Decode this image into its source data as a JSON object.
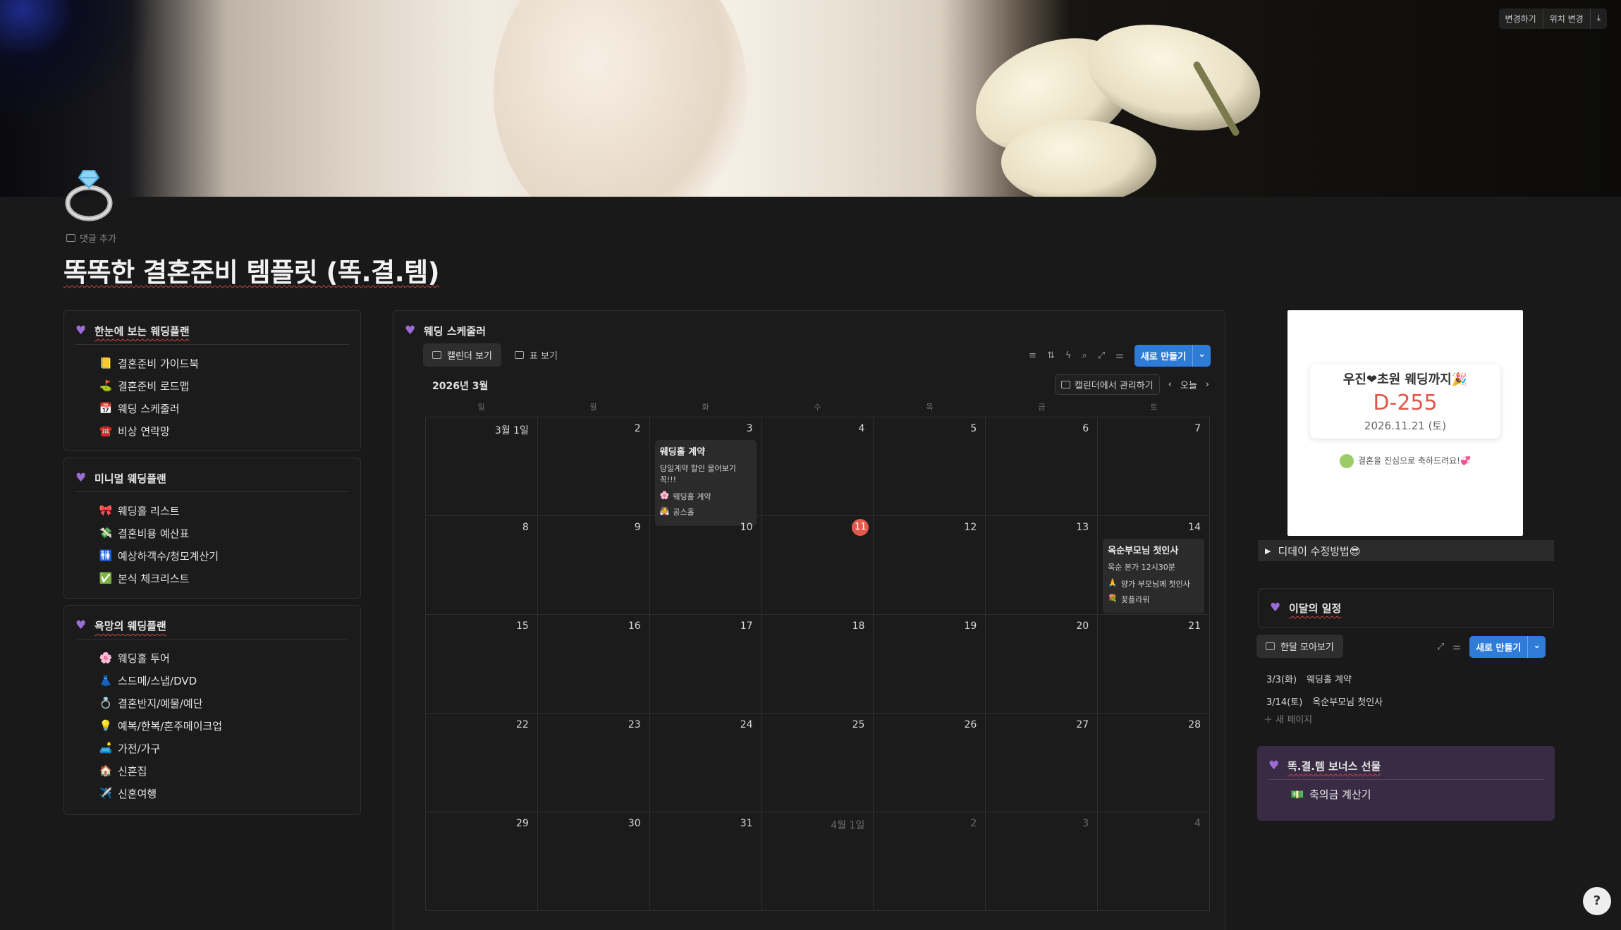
{
  "cover": {
    "change_label": "변경하기",
    "reposition_label": "위치 변경",
    "download_icon": "download-icon"
  },
  "page": {
    "icon": "ring",
    "add_comment": "댓글 추가",
    "title": "똑똑한 결혼준비 템플릿 (똑.결.템)"
  },
  "left_panels": [
    {
      "title": "한눈에 보는 웨딩플랜",
      "items": [
        {
          "emoji": "📒",
          "label": "결혼준비 가이드북"
        },
        {
          "emoji": "⛳",
          "label": "결혼준비 로드맵"
        },
        {
          "emoji": "📅",
          "label": "웨딩 스케줄러"
        },
        {
          "emoji": "☎️",
          "label": "비상 연락망"
        }
      ]
    },
    {
      "title": "미니멀 웨딩플랜",
      "items": [
        {
          "emoji": "🎀",
          "label": "웨딩홀 리스트"
        },
        {
          "emoji": "💸",
          "label": "결혼비용 예산표"
        },
        {
          "emoji": "🚻",
          "label": "예상하객수/청모계산기"
        },
        {
          "emoji": "✅",
          "label": "본식 체크리스트"
        }
      ]
    },
    {
      "title": "욕망의 웨딩플랜",
      "items": [
        {
          "emoji": "🌸",
          "label": "웨딩홀 투어"
        },
        {
          "emoji": "👗",
          "label": "스드메/스냅/DVD"
        },
        {
          "emoji": "💍",
          "label": "결혼반지/예물/예단"
        },
        {
          "emoji": "💡",
          "label": "예복/한복/혼주메이크업"
        },
        {
          "emoji": "🛋️",
          "label": "가전/가구"
        },
        {
          "emoji": "🏠",
          "label": "신혼집"
        },
        {
          "emoji": "✈️",
          "label": "신혼여행"
        }
      ]
    }
  ],
  "scheduler": {
    "title": "웨딩 스케줄러",
    "tabs": [
      "캘린더 보기",
      "표 보기"
    ],
    "new_label": "새로 만들기",
    "month": "2026년 3월",
    "manage_label": "캘린더에서 관리하기",
    "today_label": "오늘",
    "weekdays": [
      "일",
      "월",
      "화",
      "수",
      "목",
      "금",
      "토"
    ],
    "days": [
      "3월 1일",
      "2",
      "3",
      "4",
      "5",
      "6",
      "7",
      "8",
      "9",
      "10",
      "11",
      "12",
      "13",
      "14",
      "15",
      "16",
      "17",
      "18",
      "19",
      "20",
      "21",
      "22",
      "23",
      "24",
      "25",
      "26",
      "27",
      "28",
      "29",
      "30",
      "31",
      "4월 1일",
      "2",
      "3",
      "4"
    ],
    "today_index": 10,
    "events": [
      {
        "day_index": 2,
        "title": "웨딩홀 계약",
        "desc": "당일계약 할인 물어보기 꼭!!!",
        "rows": [
          {
            "emoji": "🌸",
            "text": "웨딩홀 계약"
          },
          {
            "emoji": "👰",
            "text": "공스홀"
          }
        ]
      },
      {
        "day_index": 13,
        "title": "옥순부모님 첫인사",
        "desc": "옥순 본가 12시30분",
        "rows": [
          {
            "emoji": "🙏",
            "text": "양가 부모님께 첫인사"
          },
          {
            "emoji": "💐",
            "text": "꽃플라워"
          }
        ]
      }
    ]
  },
  "dday": {
    "title": "우진❤초원 웨딩까지🎉",
    "count": "D-255",
    "date": "2026.11.21 (토)",
    "message": "결혼을 진심으로 축하드려요!💞"
  },
  "toggle": {
    "label": "디데이 수정방법😎"
  },
  "month_schedule": {
    "title": "이달의 일정",
    "tab": "한달 모아보기",
    "new_label": "새로 만들기",
    "rows": [
      {
        "date": "3/3(화)",
        "title": "웨딩홀 계약"
      },
      {
        "date": "3/14(토)",
        "title": "옥순부모님 첫인사"
      }
    ],
    "new_page": "새 페이지"
  },
  "bonus": {
    "title": "똑.결.템 보너스 선물",
    "item_emoji": "💵",
    "item": "축의금 계산기"
  },
  "colors": {
    "accent_blue": "#2f7bd8",
    "today_red": "#e25a4a",
    "heart_purple": "#9b6bd6",
    "bonus_bg": "#3a2b44"
  }
}
